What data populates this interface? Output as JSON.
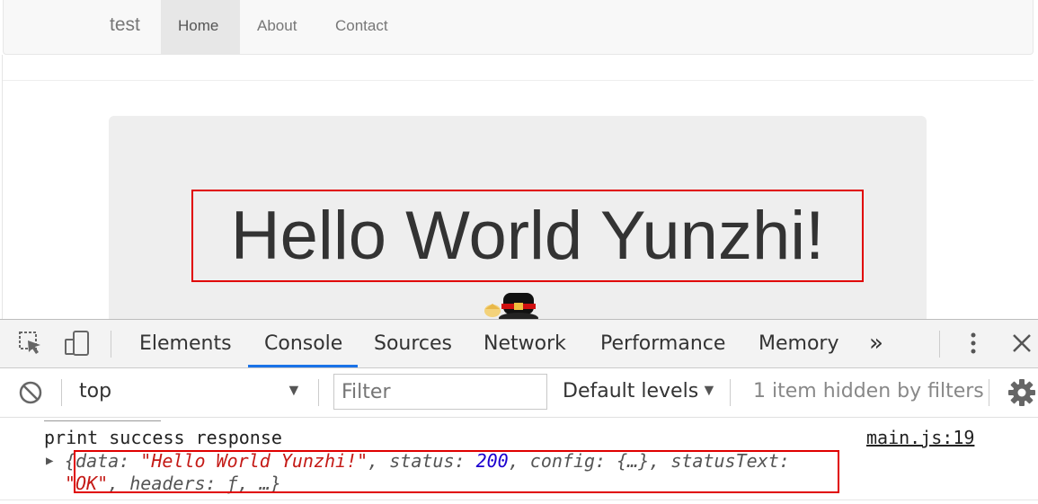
{
  "navbar": {
    "brand": "test",
    "items": [
      {
        "label": "Home",
        "active": true
      },
      {
        "label": "About",
        "active": false
      },
      {
        "label": "Contact",
        "active": false
      }
    ]
  },
  "main": {
    "heading": "Hello World Yunzhi!"
  },
  "devtools": {
    "tabs": [
      "Elements",
      "Console",
      "Sources",
      "Network",
      "Performance",
      "Memory"
    ],
    "more_tabs_glyph": "»",
    "active_tab": "Console",
    "context": "top",
    "filter_placeholder": "Filter",
    "levels": "Default levels",
    "hidden_note": "1 item hidden by filters",
    "log": {
      "message": "print success response",
      "source": "main.js:19",
      "object_open": "{",
      "data_key": "data: ",
      "data_value": "\"Hello World Yunzhi!\"",
      "status_key": ", status: ",
      "status_value": "200",
      "rest_line1": ", config: {…}, statusText:",
      "status_text_value": "\"OK\"",
      "rest_line2": ", headers: ƒ, …}"
    }
  },
  "colors": {
    "accent": "#1a73e8",
    "highlight_box": "#e00000",
    "string": "#c41a16",
    "number": "#1c00cf"
  }
}
